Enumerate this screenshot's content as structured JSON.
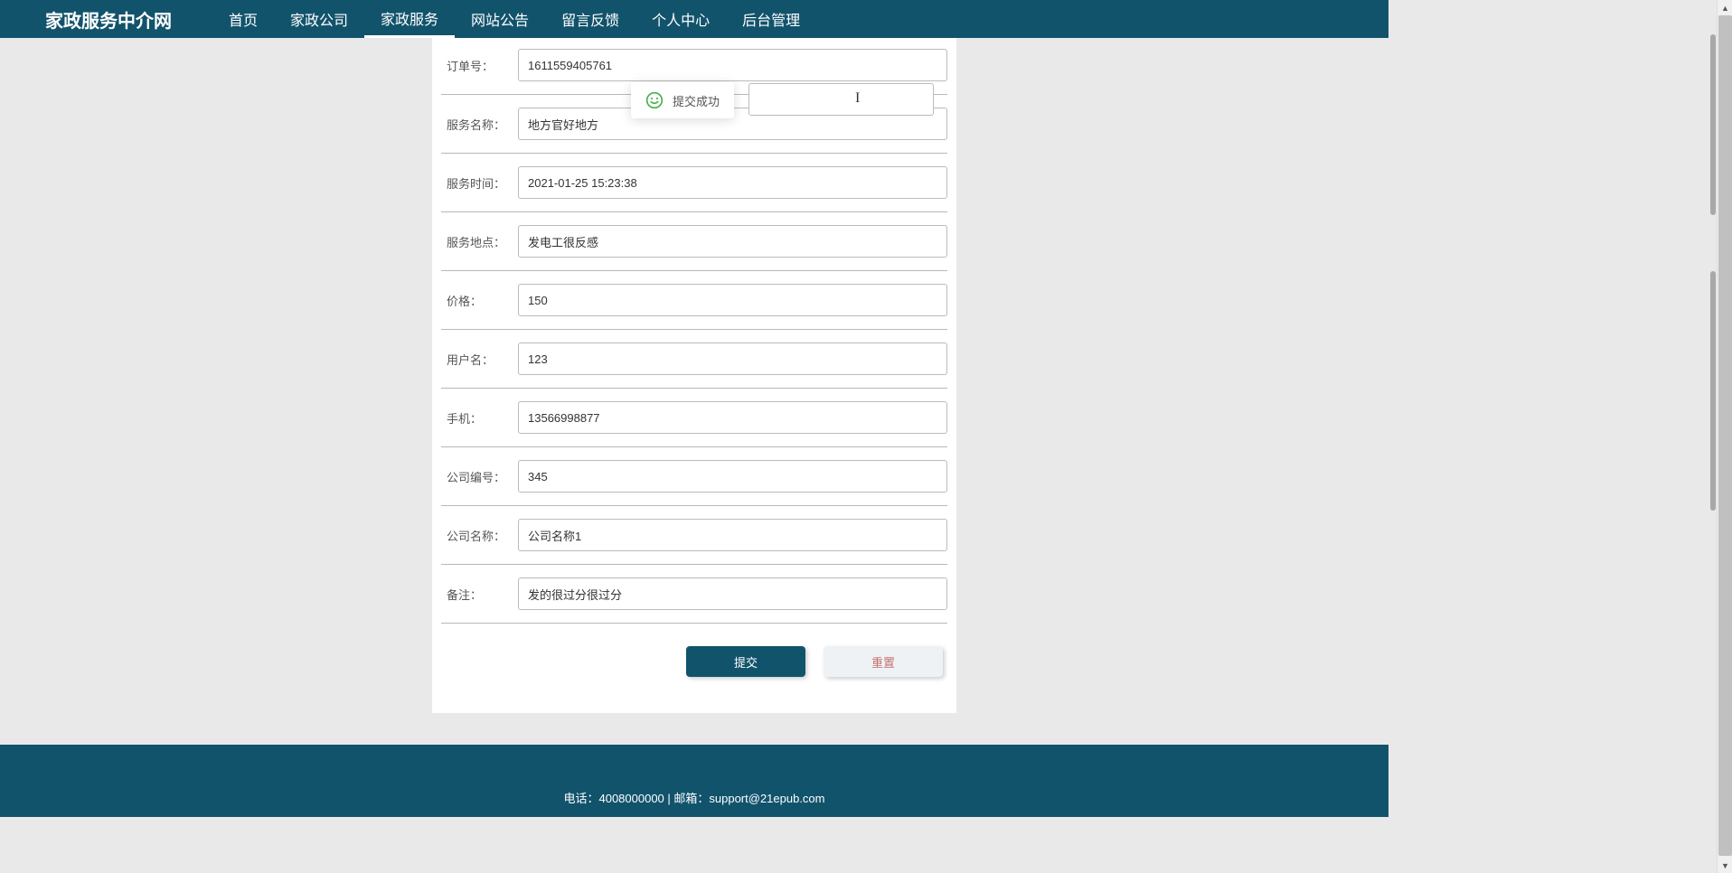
{
  "header": {
    "site_title": "家政服务中介网",
    "nav": [
      {
        "label": "首页",
        "active": false
      },
      {
        "label": "家政公司",
        "active": false
      },
      {
        "label": "家政服务",
        "active": true
      },
      {
        "label": "网站公告",
        "active": false
      },
      {
        "label": "留言反馈",
        "active": false
      },
      {
        "label": "个人中心",
        "active": false
      },
      {
        "label": "后台管理",
        "active": false
      }
    ]
  },
  "toast": {
    "message": "提交成功",
    "icon": "smile-icon"
  },
  "form": {
    "fields": [
      {
        "label": "订单号：",
        "value": "1611559405761",
        "name": "order-id"
      },
      {
        "label": "服务名称：",
        "value": "地方官好地方",
        "name": "service-name"
      },
      {
        "label": "服务时间：",
        "value": "2021-01-25 15:23:38",
        "name": "service-time"
      },
      {
        "label": "服务地点：",
        "value": "发电工很反感",
        "name": "service-location"
      },
      {
        "label": "价格：",
        "value": "150",
        "name": "price"
      },
      {
        "label": "用户名：",
        "value": "123",
        "name": "username"
      },
      {
        "label": "手机：",
        "value": "13566998877",
        "name": "phone"
      },
      {
        "label": "公司编号：",
        "value": "345",
        "name": "company-id"
      },
      {
        "label": "公司名称：",
        "value": "公司名称1",
        "name": "company-name"
      },
      {
        "label": "备注：",
        "value": "发的很过分很过分",
        "name": "remark"
      }
    ],
    "buttons": {
      "submit": "提交",
      "reset": "重置"
    }
  },
  "footer": {
    "text": "电话：4008000000 | 邮箱：support@21epub.com"
  }
}
